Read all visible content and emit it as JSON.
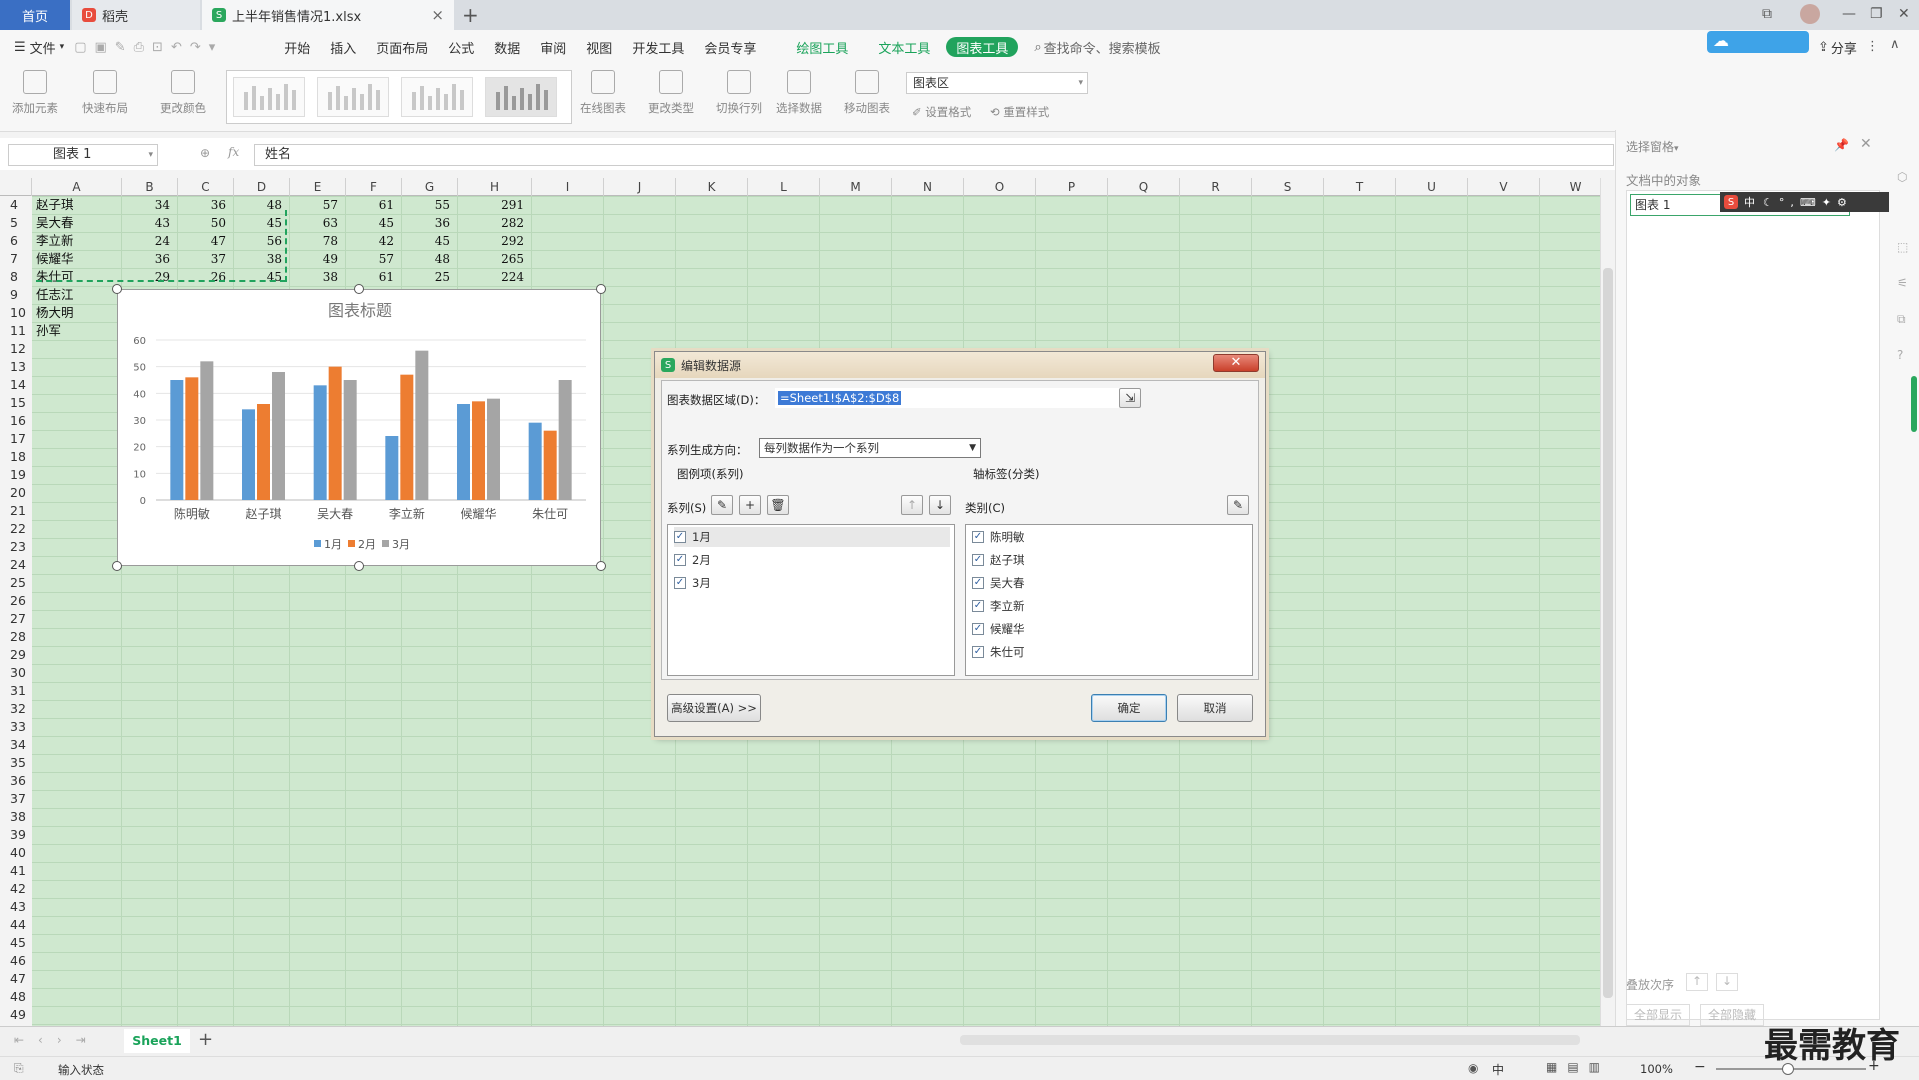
{
  "tabs": {
    "home": "首页",
    "daoke": "稻壳",
    "file": "上半年销售情况1.xlsx"
  },
  "menus": [
    "文件",
    "开始",
    "插入",
    "页面布局",
    "公式",
    "数据",
    "审阅",
    "视图",
    "开发工具",
    "会员专享",
    "绘图工具",
    "文本工具",
    "图表工具"
  ],
  "search_placeholder": "查找命令、搜索模板",
  "share": "分享",
  "ribbon": {
    "add_element": "添加元素",
    "quick_layout": "快速布局",
    "change_color": "更改颜色",
    "online_chart": "在线图表",
    "change_type": "更改类型",
    "switch_rowcol": "切换行列",
    "select_data": "选择数据",
    "move_chart": "移动图表",
    "chart_area": "图表区",
    "set_format": "设置格式",
    "reset_style": "重置样式"
  },
  "formula": {
    "namebox": "图表 1",
    "fx": "fx",
    "content": "姓名"
  },
  "columns": [
    "A",
    "B",
    "C",
    "D",
    "E",
    "F",
    "G",
    "H",
    "I",
    "J",
    "K",
    "L",
    "M",
    "N",
    "O",
    "P",
    "Q",
    "R",
    "S",
    "T",
    "U",
    "V",
    "W"
  ],
  "rows": [
    {
      "n": "4",
      "name": "赵子琪",
      "v": [
        "34",
        "36",
        "48",
        "57",
        "61",
        "55",
        "291"
      ]
    },
    {
      "n": "5",
      "name": "吴大春",
      "v": [
        "43",
        "50",
        "45",
        "63",
        "45",
        "36",
        "282"
      ]
    },
    {
      "n": "6",
      "name": "李立新",
      "v": [
        "24",
        "47",
        "56",
        "78",
        "42",
        "45",
        "292"
      ]
    },
    {
      "n": "7",
      "name": "候耀华",
      "v": [
        "36",
        "37",
        "38",
        "49",
        "57",
        "48",
        "265"
      ]
    },
    {
      "n": "8",
      "name": "朱仕可",
      "v": [
        "29",
        "26",
        "45",
        "38",
        "61",
        "25",
        "224"
      ]
    },
    {
      "n": "9",
      "name": "任志江",
      "v": []
    },
    {
      "n": "10",
      "name": "杨大明",
      "v": []
    },
    {
      "n": "11",
      "name": "孙军",
      "v": []
    }
  ],
  "empty_rows": [
    "12",
    "13",
    "14",
    "15",
    "16",
    "17",
    "18",
    "19",
    "20",
    "21",
    "22",
    "23",
    "24",
    "25",
    "26",
    "27",
    "28",
    "29",
    "30",
    "31",
    "32",
    "33",
    "34",
    "35",
    "36",
    "37",
    "38",
    "39",
    "40",
    "41",
    "42",
    "43",
    "44",
    "45",
    "46",
    "47",
    "48",
    "49"
  ],
  "chart_data": {
    "type": "bar",
    "title": "图表标题",
    "categories": [
      "陈明敏",
      "赵子琪",
      "吴大春",
      "李立新",
      "候耀华",
      "朱仕可"
    ],
    "series": [
      {
        "name": "1月",
        "color": "#5b9bd5",
        "values": [
          45,
          34,
          43,
          24,
          36,
          29
        ]
      },
      {
        "name": "2月",
        "color": "#ed7d31",
        "values": [
          46,
          36,
          50,
          47,
          37,
          26
        ]
      },
      {
        "name": "3月",
        "color": "#a5a5a5",
        "values": [
          52,
          48,
          45,
          56,
          38,
          45
        ]
      }
    ],
    "yticks": [
      "0",
      "10",
      "20",
      "30",
      "40",
      "50",
      "60"
    ],
    "ylim": [
      0,
      60
    ],
    "legend": "bottom"
  },
  "dialog": {
    "title": "编辑数据源",
    "range_label": "图表数据区域(D)：",
    "range_value": "=Sheet1!$A$2:$D$8",
    "direction_label": "系列生成方向：",
    "direction_value": "每列数据作为一个系列",
    "legend_group": "图例项(系列)",
    "axis_group": "轴标签(分类)",
    "series_label": "系列(S)",
    "category_label": "类别(C)",
    "series_items": [
      "1月",
      "2月",
      "3月"
    ],
    "category_items": [
      "陈明敏",
      "赵子琪",
      "吴大春",
      "李立新",
      "候耀华",
      "朱仕可"
    ],
    "advanced": "高级设置(A) >>",
    "ok": "确定",
    "cancel": "取消"
  },
  "panel": {
    "title": "选择窗格",
    "objects_label": "文档中的对象",
    "item": "图表 1",
    "order": "叠放次序",
    "show_all": "全部显示",
    "hide_all": "全部隐藏"
  },
  "sheet_tab": "Sheet1",
  "status": {
    "input": "输入状态",
    "zoom": "100%",
    "lang": "中"
  },
  "watermark": "最需教育",
  "ime": "中"
}
